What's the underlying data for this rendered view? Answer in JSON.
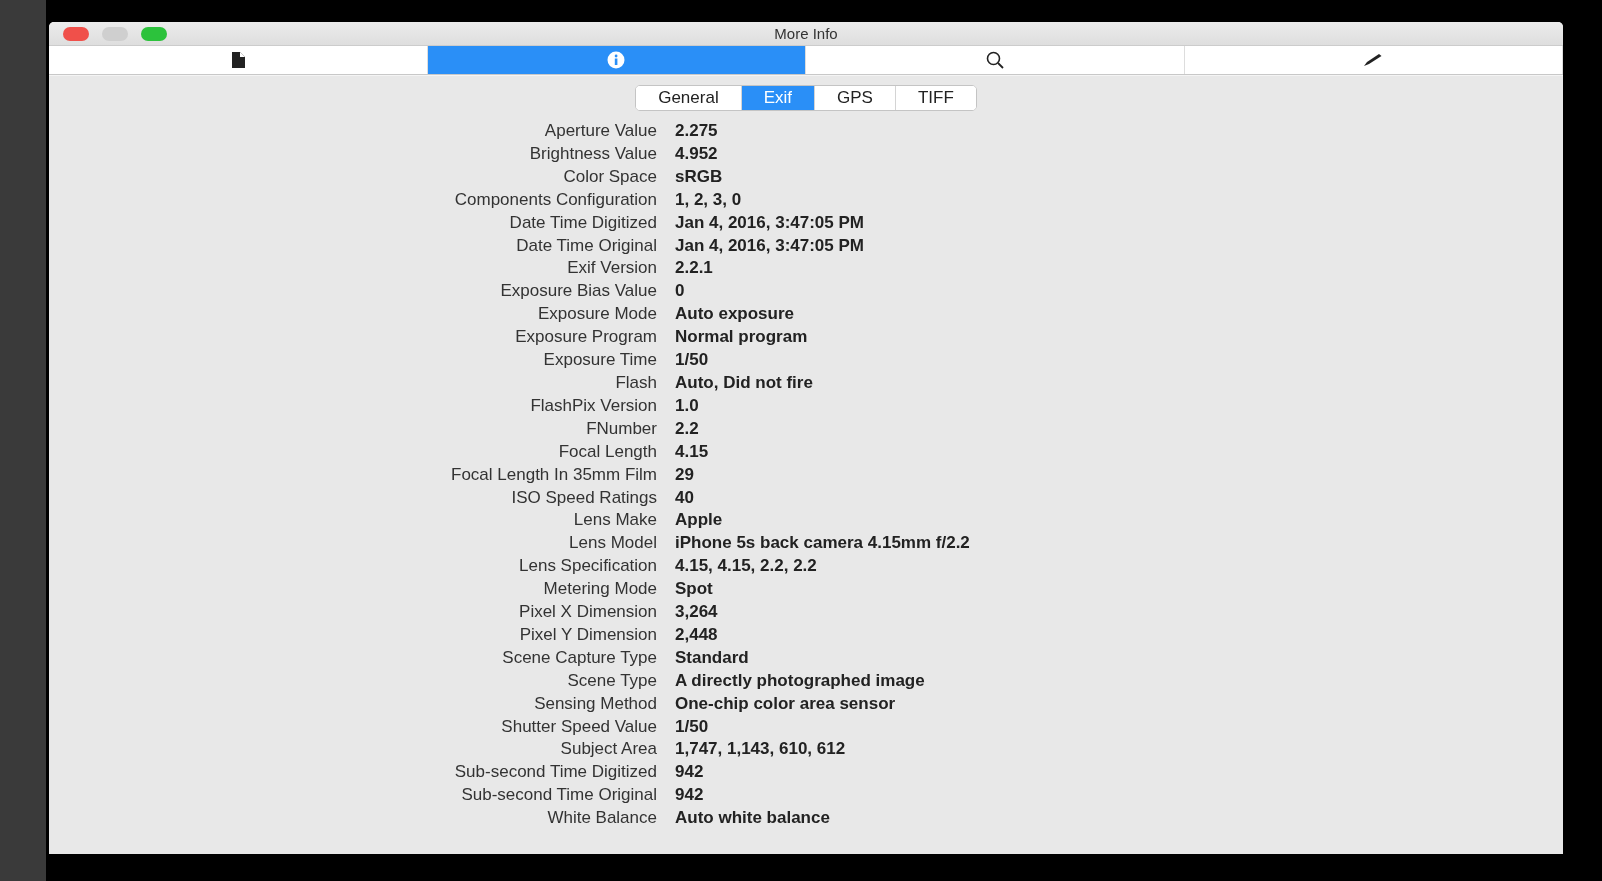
{
  "window": {
    "title": "More Info"
  },
  "toolbar_tabs": [
    {
      "kind": "document",
      "selected": false
    },
    {
      "kind": "info",
      "selected": true
    },
    {
      "kind": "search",
      "selected": false
    },
    {
      "kind": "pencil",
      "selected": false
    }
  ],
  "segments": [
    {
      "label": "General",
      "selected": false
    },
    {
      "label": "Exif",
      "selected": true
    },
    {
      "label": "GPS",
      "selected": false
    },
    {
      "label": "TIFF",
      "selected": false
    }
  ],
  "properties": [
    {
      "label": "Aperture Value",
      "value": "2.275"
    },
    {
      "label": "Brightness Value",
      "value": "4.952"
    },
    {
      "label": "Color Space",
      "value": "sRGB"
    },
    {
      "label": "Components Configuration",
      "value": "1, 2, 3, 0"
    },
    {
      "label": "Date Time Digitized",
      "value": "Jan 4, 2016, 3:47:05 PM"
    },
    {
      "label": "Date Time Original",
      "value": "Jan 4, 2016, 3:47:05 PM"
    },
    {
      "label": "Exif Version",
      "value": "2.2.1"
    },
    {
      "label": "Exposure Bias Value",
      "value": "0"
    },
    {
      "label": "Exposure Mode",
      "value": "Auto exposure"
    },
    {
      "label": "Exposure Program",
      "value": "Normal program"
    },
    {
      "label": "Exposure Time",
      "value": "1/50"
    },
    {
      "label": "Flash",
      "value": "Auto, Did not fire"
    },
    {
      "label": "FlashPix Version",
      "value": "1.0"
    },
    {
      "label": "FNumber",
      "value": "2.2"
    },
    {
      "label": "Focal Length",
      "value": "4.15"
    },
    {
      "label": "Focal Length In 35mm Film",
      "value": "29"
    },
    {
      "label": "ISO Speed Ratings",
      "value": "40"
    },
    {
      "label": "Lens Make",
      "value": "Apple"
    },
    {
      "label": "Lens Model",
      "value": "iPhone 5s back camera 4.15mm f/2.2"
    },
    {
      "label": "Lens Specification",
      "value": "4.15, 4.15, 2.2, 2.2"
    },
    {
      "label": "Metering Mode",
      "value": "Spot"
    },
    {
      "label": "Pixel X Dimension",
      "value": "3,264"
    },
    {
      "label": "Pixel Y Dimension",
      "value": "2,448"
    },
    {
      "label": "Scene Capture Type",
      "value": "Standard"
    },
    {
      "label": "Scene Type",
      "value": "A directly photographed image"
    },
    {
      "label": "Sensing Method",
      "value": "One-chip color area sensor"
    },
    {
      "label": "Shutter Speed Value",
      "value": "1/50"
    },
    {
      "label": "Subject Area",
      "value": "1,747, 1,143, 610, 612"
    },
    {
      "label": "Sub-second Time Digitized",
      "value": "942"
    },
    {
      "label": "Sub-second Time Original",
      "value": "942"
    },
    {
      "label": "White Balance",
      "value": "Auto white balance"
    }
  ]
}
